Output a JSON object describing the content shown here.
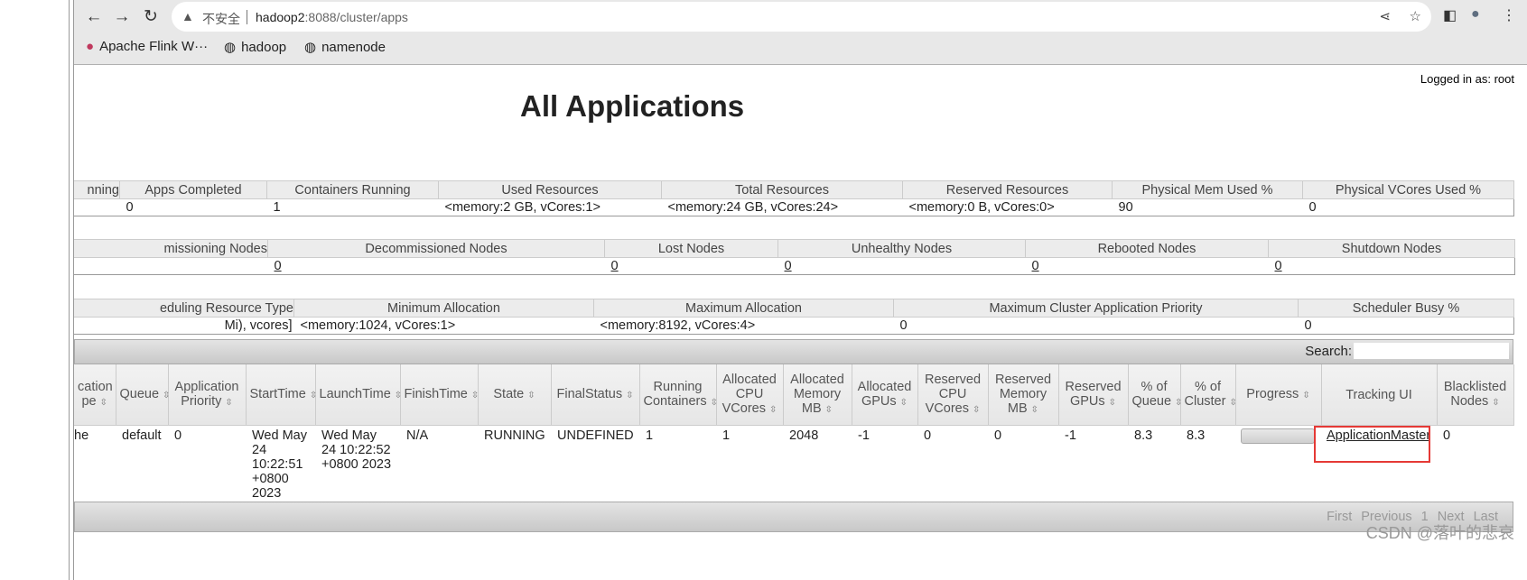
{
  "browser": {
    "insecure_label": "不安全",
    "url_host": "hadoop2",
    "url_rest": ":8088/cluster/apps",
    "bookmarks": [
      {
        "label": "Apache Flink W···",
        "icon": "flink-icon"
      },
      {
        "label": "hadoop",
        "icon": "globe-icon"
      },
      {
        "label": "namenode",
        "icon": "globe-icon"
      }
    ]
  },
  "page": {
    "logged_in": "Logged in as: root",
    "title": "All Applications"
  },
  "metrics": {
    "headers": [
      "nning",
      "Apps Completed",
      "Containers Running",
      "Used Resources",
      "Total Resources",
      "Reserved Resources",
      "Physical Mem Used %",
      "Physical VCores Used %"
    ],
    "values": [
      "",
      "0",
      "1",
      "<memory:2 GB, vCores:1>",
      "<memory:24 GB, vCores:24>",
      "<memory:0 B, vCores:0>",
      "90",
      "0"
    ]
  },
  "nodes": {
    "headers": [
      "missioning Nodes",
      "Decommissioned Nodes",
      "Lost Nodes",
      "Unhealthy Nodes",
      "Rebooted Nodes",
      "Shutdown Nodes"
    ],
    "values": [
      "",
      "0",
      "0",
      "0",
      "0",
      "0"
    ]
  },
  "scheduler": {
    "headers": [
      "eduling Resource Type",
      "Minimum Allocation",
      "Maximum Allocation",
      "Maximum Cluster Application Priority",
      "Scheduler Busy %"
    ],
    "values": [
      "Mi), vcores]",
      "<memory:1024, vCores:1>",
      "<memory:8192, vCores:4>",
      "0",
      "0"
    ]
  },
  "apps": {
    "search_label": "Search:",
    "search_value": "",
    "columns": [
      "cation pe",
      "Queue",
      "Application Priority",
      "StartTime",
      "LaunchTime",
      "FinishTime",
      "State",
      "FinalStatus",
      "Running Containers",
      "Allocated CPU VCores",
      "Allocated Memory MB",
      "Allocated GPUs",
      "Reserved CPU VCores",
      "Reserved Memory MB",
      "Reserved GPUs",
      "% of Queue",
      "% of Cluster",
      "Progress",
      "Tracking UI",
      "Blacklisted Nodes"
    ],
    "row": {
      "type": "he",
      "queue": "default",
      "priority": "0",
      "start": "Wed May 24 10:22:51 +0800 2023",
      "launch": "Wed May 24 10:22:52 +0800 2023",
      "finish": "N/A",
      "state": "RUNNING",
      "final": "UNDEFINED",
      "running": "1",
      "alloc_vcores": "1",
      "alloc_mem": "2048",
      "alloc_gpus": "-1",
      "res_vcores": "0",
      "res_mem": "0",
      "res_gpus": "-1",
      "pct_queue": "8.3",
      "pct_cluster": "8.3",
      "progress_pct": 0,
      "tracking": "ApplicationMaster",
      "blacklisted": "0"
    },
    "pager": [
      "First",
      "Previous",
      "1",
      "Next",
      "Last"
    ]
  },
  "watermark": "CSDN @落叶的悲哀",
  "colors": {
    "highlight_box": "#e53935"
  }
}
